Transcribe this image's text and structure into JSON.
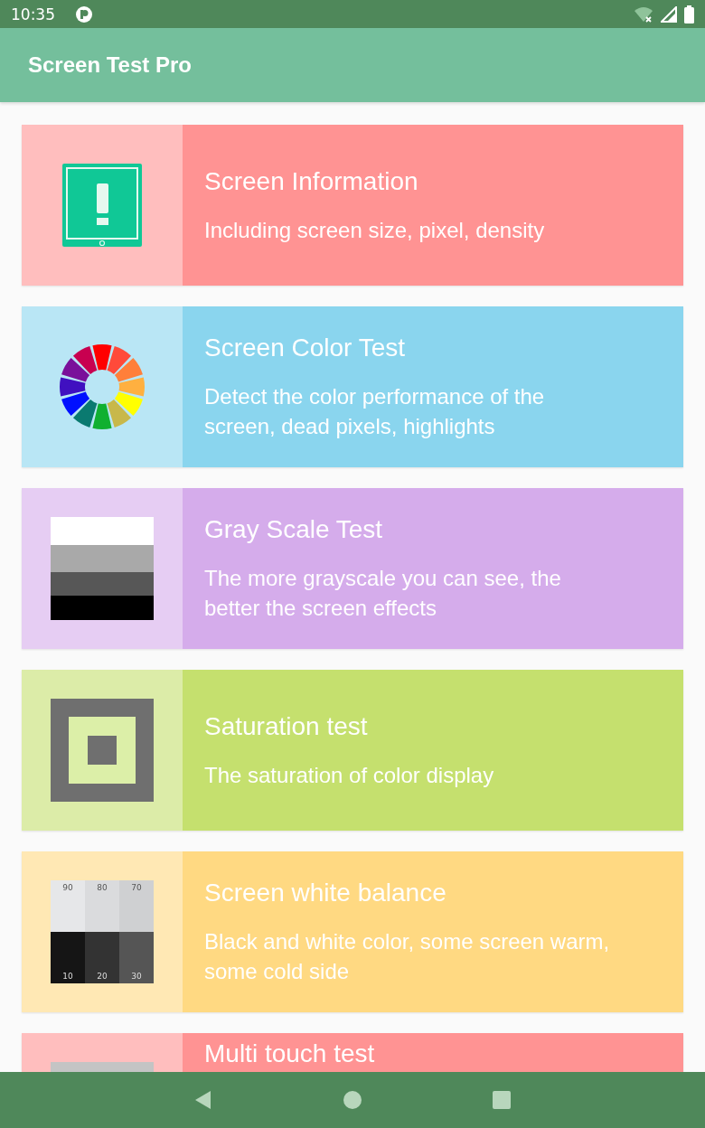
{
  "status_bar": {
    "time": "10:35"
  },
  "app_bar": {
    "title": "Screen Test Pro"
  },
  "cards": [
    {
      "kind": "info",
      "title": "Screen Information",
      "description": "Including screen size, pixel, density",
      "color": "#ff9393"
    },
    {
      "kind": "color-wheel",
      "title": "Screen Color Test",
      "description": "Detect the color performance of the screen, dead pixels, highlights",
      "color": "#8ad5ee"
    },
    {
      "kind": "grayscale",
      "title": "Gray Scale Test",
      "description": "The more grayscale you can see, the better the screen effects",
      "color": "#d5aceb"
    },
    {
      "kind": "saturation",
      "title": "Saturation test",
      "description": "The saturation of color display",
      "color": "#c5e06e"
    },
    {
      "kind": "white-balance",
      "title": "Screen white balance",
      "description": "Black and white color, some screen warm, some cold side",
      "color": "#ffd982",
      "icon_labels": [
        "90",
        "80",
        "70",
        "10",
        "20",
        "30"
      ]
    },
    {
      "kind": "touch",
      "title": "Multi touch test",
      "color": "#ff9393"
    }
  ]
}
